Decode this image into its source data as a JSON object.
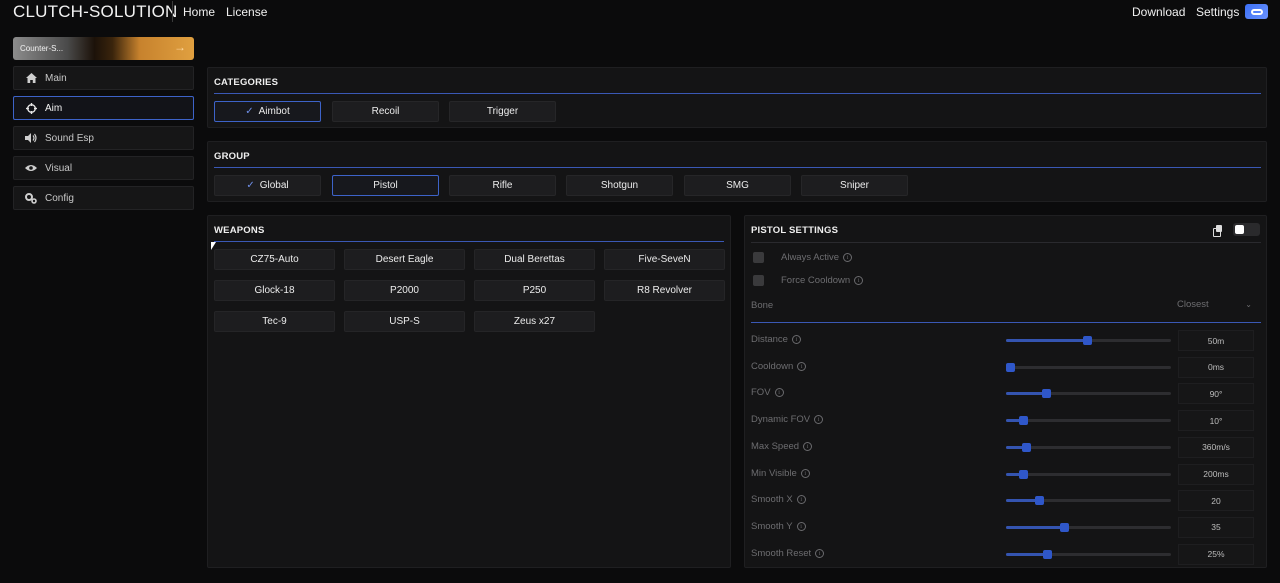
{
  "header": {
    "brand": "CLUTCH-SOLUTION",
    "nav": [
      "Home",
      "License"
    ],
    "right_links": [
      "Download",
      "Settings"
    ]
  },
  "sidebar": {
    "game_banner_label": "Counter-S...",
    "items": [
      {
        "label": "Main",
        "icon": "home-icon"
      },
      {
        "label": "Aim",
        "icon": "crosshair-icon"
      },
      {
        "label": "Sound Esp",
        "icon": "speaker-icon"
      },
      {
        "label": "Visual",
        "icon": "eye-icon"
      },
      {
        "label": "Config",
        "icon": "gears-icon"
      }
    ],
    "active": "Aim"
  },
  "categories": {
    "title": "CATEGORIES",
    "items": [
      "Aimbot",
      "Recoil",
      "Trigger"
    ],
    "selected": "Aimbot"
  },
  "group": {
    "title": "GROUP",
    "items": [
      "Global",
      "Pistol",
      "Rifle",
      "Shotgun",
      "SMG",
      "Sniper"
    ],
    "checked": "Global",
    "selected": "Pistol"
  },
  "weapons": {
    "title": "WEAPONS",
    "items": [
      "CZ75-Auto",
      "Desert Eagle",
      "Dual Berettas",
      "Five-SeveN",
      "Glock-18",
      "P2000",
      "P250",
      "R8 Revolver",
      "Tec-9",
      "USP-S",
      "Zeus x27"
    ]
  },
  "settings": {
    "title": "PISTOL SETTINGS",
    "checkboxes": [
      {
        "label": "Always Active",
        "checked": false
      },
      {
        "label": "Force Cooldown",
        "checked": false
      }
    ],
    "bone": {
      "label": "Bone",
      "value": "Closest"
    },
    "sliders": [
      {
        "label": "Distance",
        "value": "50m",
        "fraction": 0.49
      },
      {
        "label": "Cooldown",
        "value": "0ms",
        "fraction": 0.0
      },
      {
        "label": "FOV",
        "value": "90°",
        "fraction": 0.24
      },
      {
        "label": "Dynamic FOV",
        "value": "10°",
        "fraction": 0.1
      },
      {
        "label": "Max Speed",
        "value": "360m/s",
        "fraction": 0.12
      },
      {
        "label": "Min Visible",
        "value": "200ms",
        "fraction": 0.1
      },
      {
        "label": "Smooth X",
        "value": "20",
        "fraction": 0.2
      },
      {
        "label": "Smooth Y",
        "value": "35",
        "fraction": 0.35
      },
      {
        "label": "Smooth Reset",
        "value": "25%",
        "fraction": 0.25
      }
    ]
  }
}
